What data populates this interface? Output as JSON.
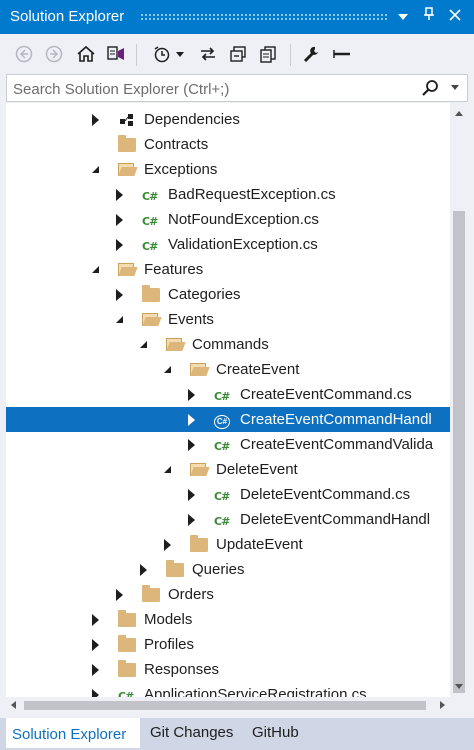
{
  "window": {
    "title": "Solution Explorer"
  },
  "search": {
    "placeholder": "Search Solution Explorer (Ctrl+;)"
  },
  "tree": [
    {
      "label": "Dependencies",
      "icon": "dependencies-icon",
      "state": "collapsed",
      "indent": 0
    },
    {
      "label": "Contracts",
      "icon": "folder-icon",
      "state": "none",
      "indent": 0
    },
    {
      "label": "Exceptions",
      "icon": "folder-open-icon",
      "state": "expanded",
      "indent": 0
    },
    {
      "label": "BadRequestException.cs",
      "icon": "csharp-file-icon",
      "state": "collapsed",
      "indent": 1
    },
    {
      "label": "NotFoundException.cs",
      "icon": "csharp-file-icon",
      "state": "collapsed",
      "indent": 1
    },
    {
      "label": "ValidationException.cs",
      "icon": "csharp-file-icon",
      "state": "collapsed",
      "indent": 1
    },
    {
      "label": "Features",
      "icon": "folder-open-icon",
      "state": "expanded",
      "indent": 0
    },
    {
      "label": "Categories",
      "icon": "folder-icon",
      "state": "collapsed",
      "indent": 1
    },
    {
      "label": "Events",
      "icon": "folder-open-icon",
      "state": "expanded",
      "indent": 1
    },
    {
      "label": "Commands",
      "icon": "folder-open-icon",
      "state": "expanded",
      "indent": 2
    },
    {
      "label": "CreateEvent",
      "icon": "folder-open-icon",
      "state": "expanded",
      "indent": 3
    },
    {
      "label": "CreateEventCommand.cs",
      "icon": "csharp-file-icon",
      "state": "collapsed",
      "indent": 4
    },
    {
      "label": "CreateEventCommandHandl",
      "icon": "csharp-file-icon",
      "state": "collapsed",
      "indent": 4,
      "selected": true
    },
    {
      "label": "CreateEventCommandValida",
      "icon": "csharp-file-icon",
      "state": "collapsed",
      "indent": 4
    },
    {
      "label": "DeleteEvent",
      "icon": "folder-open-icon",
      "state": "expanded",
      "indent": 3
    },
    {
      "label": "DeleteEventCommand.cs",
      "icon": "csharp-file-icon",
      "state": "collapsed",
      "indent": 4
    },
    {
      "label": "DeleteEventCommandHandl",
      "icon": "csharp-file-icon",
      "state": "collapsed",
      "indent": 4
    },
    {
      "label": "UpdateEvent",
      "icon": "folder-icon",
      "state": "collapsed",
      "indent": 3
    },
    {
      "label": "Queries",
      "icon": "folder-icon",
      "state": "collapsed",
      "indent": 2
    },
    {
      "label": "Orders",
      "icon": "folder-icon",
      "state": "collapsed",
      "indent": 1
    },
    {
      "label": "Models",
      "icon": "folder-icon",
      "state": "collapsed",
      "indent": 0
    },
    {
      "label": "Profiles",
      "icon": "folder-icon",
      "state": "collapsed",
      "indent": 0
    },
    {
      "label": "Responses",
      "icon": "folder-icon",
      "state": "collapsed",
      "indent": 0
    },
    {
      "label": "ApplicationServiceRegistration.cs",
      "icon": "csharp-file-icon",
      "state": "collapsed",
      "indent": 0
    }
  ],
  "tabs": [
    {
      "label": "Solution Explorer",
      "active": true
    },
    {
      "label": "Git Changes",
      "active": false
    },
    {
      "label": "GitHub",
      "active": false
    }
  ],
  "colors": {
    "accent": "#007acc",
    "selection": "#0e70c0",
    "folder": "#dcb67a",
    "csharp": "#388a34"
  }
}
